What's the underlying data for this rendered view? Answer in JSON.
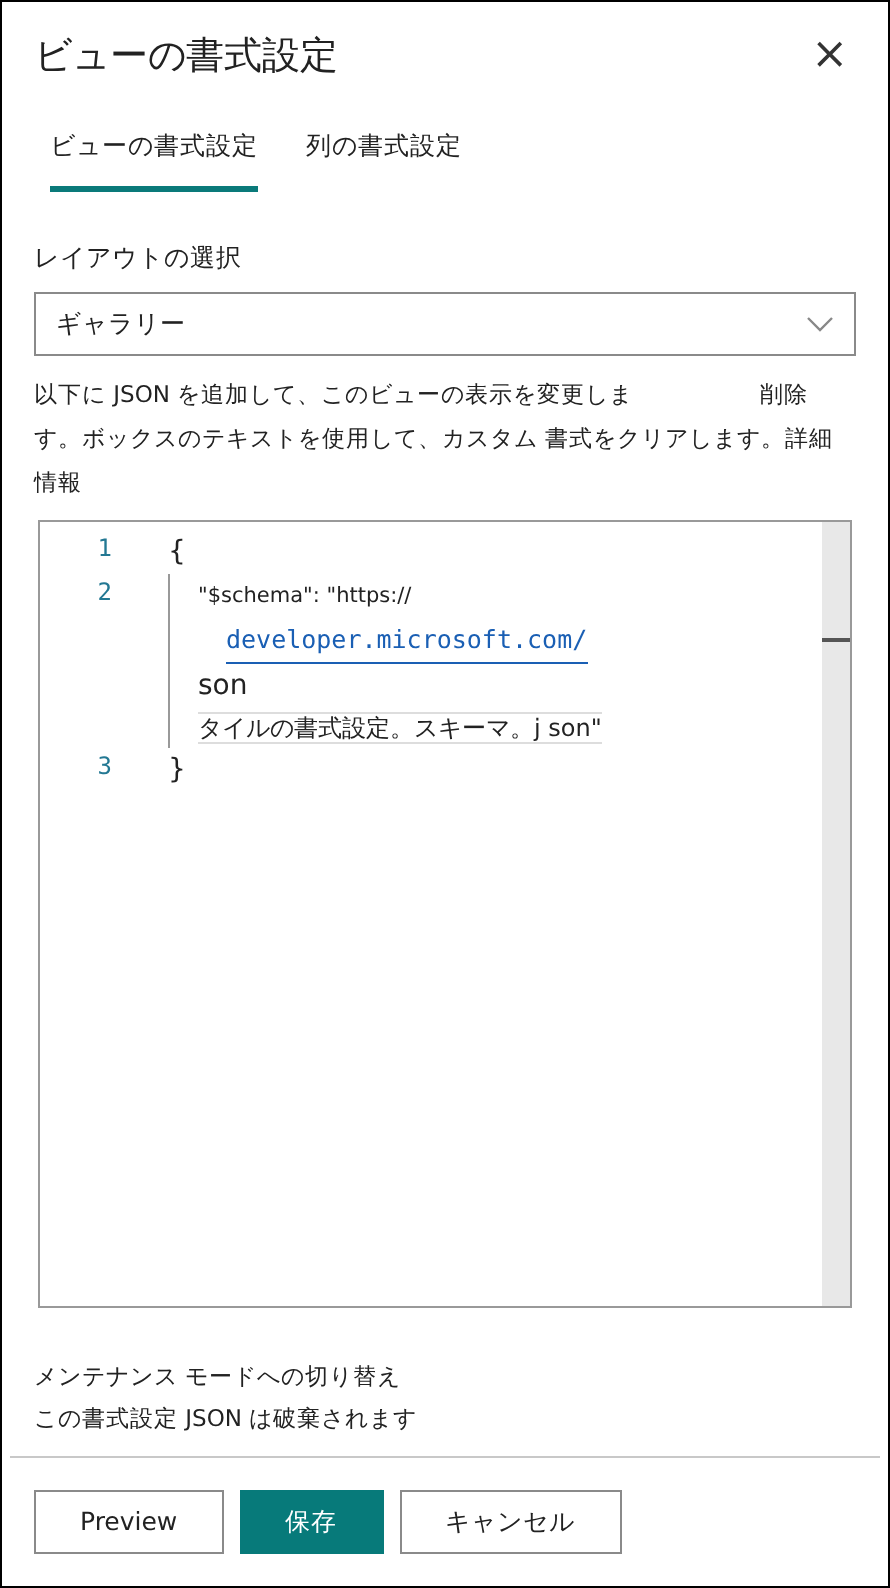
{
  "panel": {
    "title": "ビューの書式設定",
    "close": "×"
  },
  "tabs": [
    {
      "label": "ビューの書式設定",
      "selected": true
    },
    {
      "label": "列の書式設定",
      "selected": false
    }
  ],
  "layout": {
    "label": "レイアウトの選択",
    "value": "ギャラリー"
  },
  "description": {
    "line_1": "以下に JSON を追加して、このビューの表示を変更しま",
    "delete": "削除",
    "line_2": "す。ボックスのテキストを使用して、カスタム 書式をクリアします。詳細情報"
  },
  "editor": {
    "lines": [
      {
        "number": "1",
        "segments": [
          {
            "kind": "plain",
            "text": "{"
          }
        ]
      },
      {
        "number": "2",
        "segments": [
          {
            "kind": "small",
            "text": "\"$schema\": \"https://"
          },
          {
            "kind": "link",
            "text": "developer.microsoft.com/"
          },
          {
            "kind": "plain",
            "text": "son"
          },
          {
            "kind": "current",
            "text": "タイルの書式設定。スキーマ。j son\""
          }
        ]
      },
      {
        "number": "3",
        "segments": [
          {
            "kind": "plain",
            "text": "}"
          }
        ]
      }
    ]
  },
  "footer": {
    "mode_link": "メンテナンス モードへの切り替え",
    "note": "この書式設定 JSON は破棄されます"
  },
  "buttons": [
    {
      "label": "Preview",
      "kind": "default"
    },
    {
      "label": "保存",
      "kind": "primary"
    },
    {
      "label": "キャンセル",
      "kind": "default"
    }
  ]
}
